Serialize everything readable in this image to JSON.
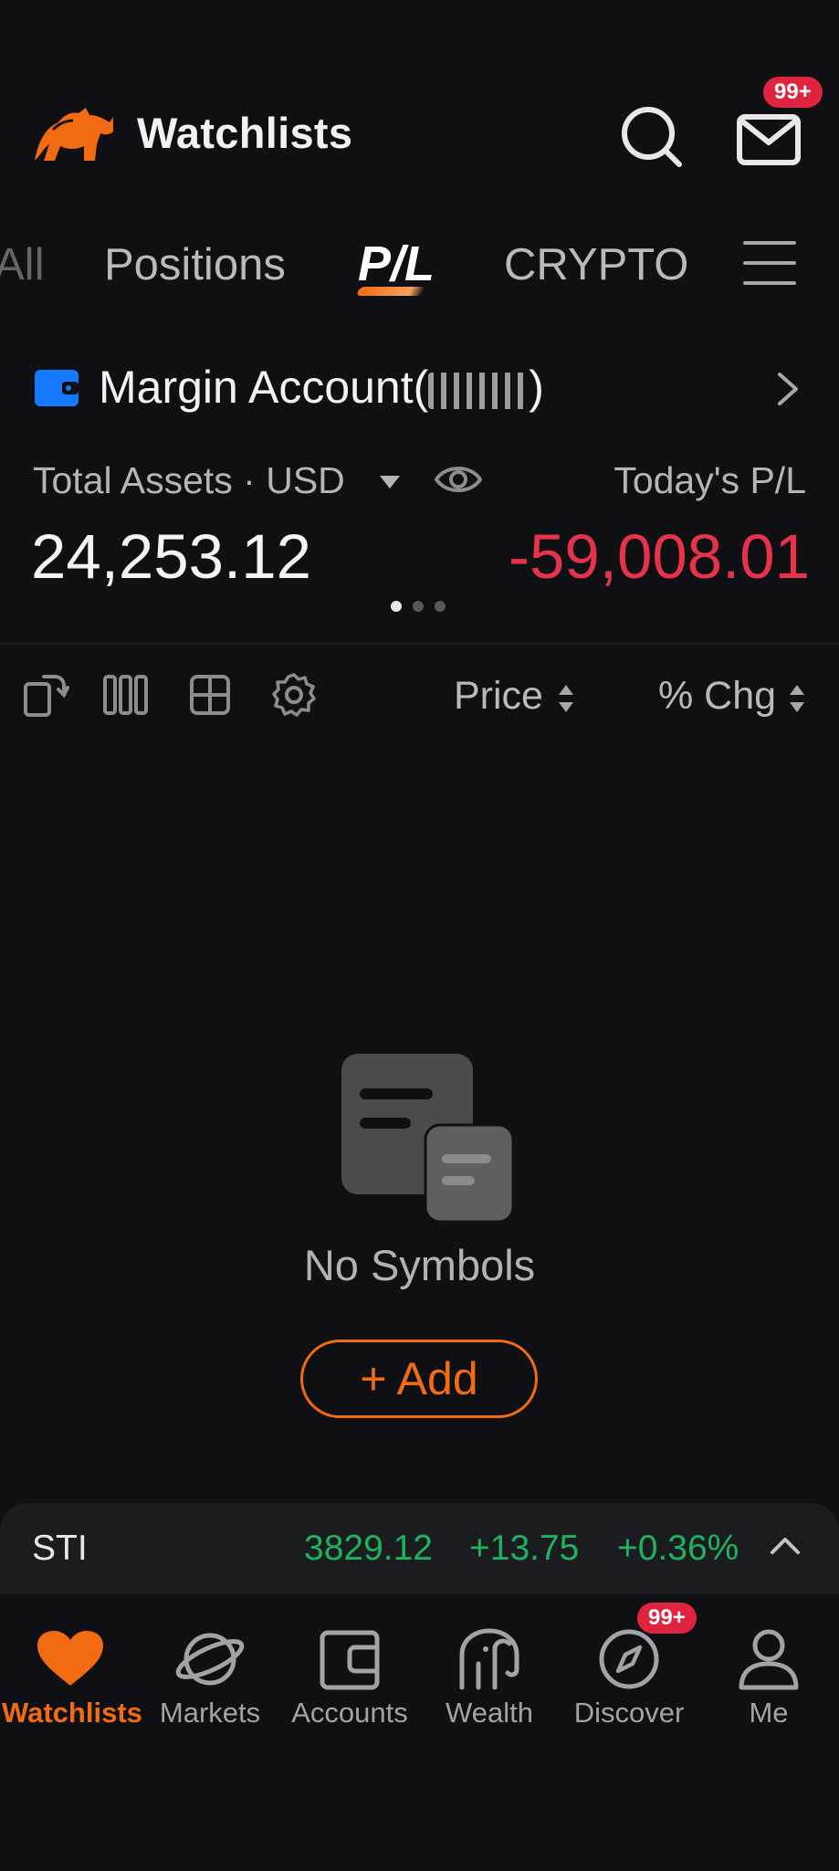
{
  "header": {
    "title": "Watchlists",
    "mail_badge": "99+"
  },
  "tabs": [
    {
      "label": "All"
    },
    {
      "label": "Positions"
    },
    {
      "label": "P/L",
      "active": true
    },
    {
      "label": "CRYPTO"
    }
  ],
  "account": {
    "name_prefix": "Margin Account(",
    "name_suffix": ")",
    "total_label": "Total Assets · USD",
    "total_value": "24,253.12",
    "today_label": "Today's P/L",
    "today_value": "-59,008.01",
    "pager_dots": 3,
    "pager_active": 0
  },
  "toolbar": {
    "price_label": "Price",
    "pct_label": "% Chg"
  },
  "empty_state": {
    "text": "No Symbols",
    "add_label": "+ Add"
  },
  "ticker": {
    "name": "STI",
    "price": "3829.12",
    "change": "+13.75",
    "pct": "+0.36%"
  },
  "nav": {
    "items": [
      {
        "label": "Watchlists",
        "icon": "heart-icon",
        "active": true
      },
      {
        "label": "Markets",
        "icon": "planet-icon"
      },
      {
        "label": "Accounts",
        "icon": "wallet-icon"
      },
      {
        "label": "Wealth",
        "icon": "elephant-icon"
      },
      {
        "label": "Discover",
        "icon": "compass-icon"
      },
      {
        "label": "Me",
        "icon": "person-icon"
      }
    ],
    "discover_badge": "99+"
  },
  "colors": {
    "background": "#0f1013",
    "accent": "#f26a12",
    "loss": "#e6334b",
    "gain": "#1fb25e",
    "badge": "#e0243f"
  }
}
